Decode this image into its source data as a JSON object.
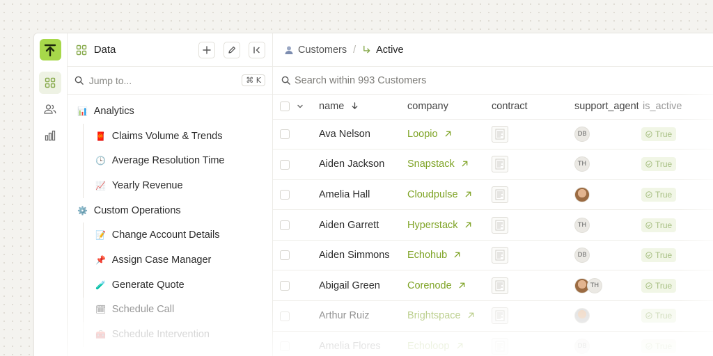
{
  "sidebar": {
    "title": "Data",
    "search_placeholder": "Jump to...",
    "shortcut": "⌘ K",
    "groups": [
      {
        "label": "Analytics",
        "icon": "📊",
        "items": [
          {
            "label": "Claims Volume & Trends",
            "icon": "🧧"
          },
          {
            "label": "Average Resolution Time",
            "icon": "🕒"
          },
          {
            "label": "Yearly Revenue",
            "icon": "📈"
          }
        ]
      },
      {
        "label": "Custom Operations",
        "icon": "⚙️",
        "items": [
          {
            "label": "Change Account Details",
            "icon": "📝"
          },
          {
            "label": "Assign Case Manager",
            "icon": "📌"
          },
          {
            "label": "Generate Quote",
            "icon": "🧪"
          },
          {
            "label": "Schedule Call",
            "icon": "🗓"
          },
          {
            "label": "Schedule Intervention",
            "icon": "🧰"
          }
        ]
      }
    ]
  },
  "breadcrumb": {
    "parent": "Customers",
    "current": "Active"
  },
  "search": {
    "placeholder": "Search within 993 Customers"
  },
  "table": {
    "columns": [
      "name",
      "company",
      "contract",
      "support_agent",
      "is_active"
    ],
    "rows": [
      {
        "name": "Ava Nelson",
        "company": "Loopio",
        "agents": [
          "DB"
        ],
        "is_active": "True"
      },
      {
        "name": "Aiden Jackson",
        "company": "Snapstack",
        "agents": [
          "TH"
        ],
        "is_active": "True"
      },
      {
        "name": "Amelia Hall",
        "company": "Cloudpulse",
        "agents": [
          "photo"
        ],
        "is_active": "True"
      },
      {
        "name": "Aiden Garrett",
        "company": "Hyperstack",
        "agents": [
          "TH"
        ],
        "is_active": "True"
      },
      {
        "name": "Aiden Simmons",
        "company": "Echohub",
        "agents": [
          "DB"
        ],
        "is_active": "True"
      },
      {
        "name": "Abigail Green",
        "company": "Corenode",
        "agents": [
          "photo",
          "TH"
        ],
        "is_active": "True"
      },
      {
        "name": "Arthur Ruiz",
        "company": "Brightspace",
        "agents": [
          "photo2"
        ],
        "is_active": "True"
      },
      {
        "name": "Amelia Flores",
        "company": "Echoloop",
        "agents": [
          "DB"
        ],
        "is_active": "True"
      }
    ]
  },
  "colors": {
    "accent": "#a7d84a",
    "company_link": "#7ea325"
  }
}
